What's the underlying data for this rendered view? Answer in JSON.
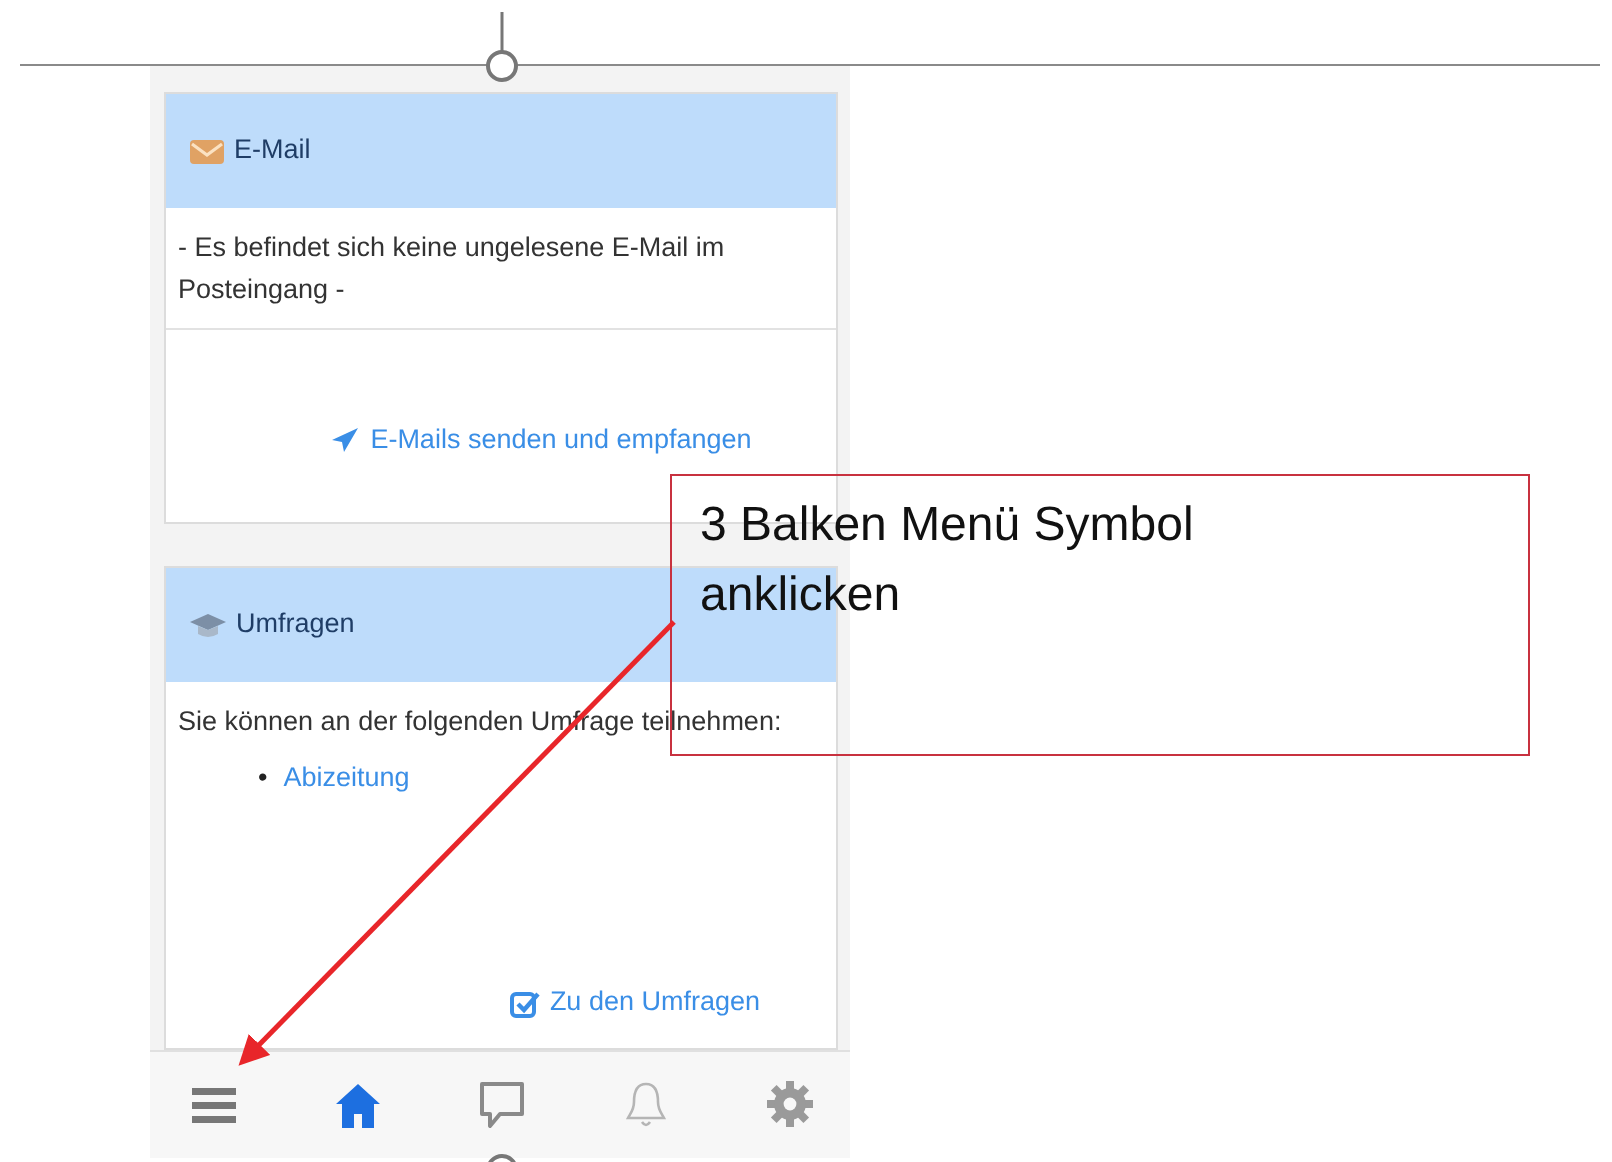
{
  "cards": [
    {
      "kind": "email",
      "title": "E-Mail",
      "body": "- Es befindet sich keine ungelesene E-Mail im Posteingang -",
      "action": "E-Mails senden und empfangen"
    },
    {
      "kind": "survey",
      "title": "Umfragen",
      "body": "Sie können an der folgenden Umfrage teilnehmen:",
      "items": [
        {
          "bullet": "•",
          "text": "Abizeitung"
        }
      ],
      "action": "Zu den Umfragen"
    }
  ],
  "bottom_nav": [
    {
      "kind": "menu",
      "selected": false
    },
    {
      "kind": "home",
      "selected": true
    },
    {
      "kind": "chat",
      "selected": false
    },
    {
      "kind": "bell",
      "selected": false
    },
    {
      "kind": "settings",
      "selected": false
    }
  ],
  "callout": {
    "text": "3 Balken Menü Symbol anklicken"
  }
}
